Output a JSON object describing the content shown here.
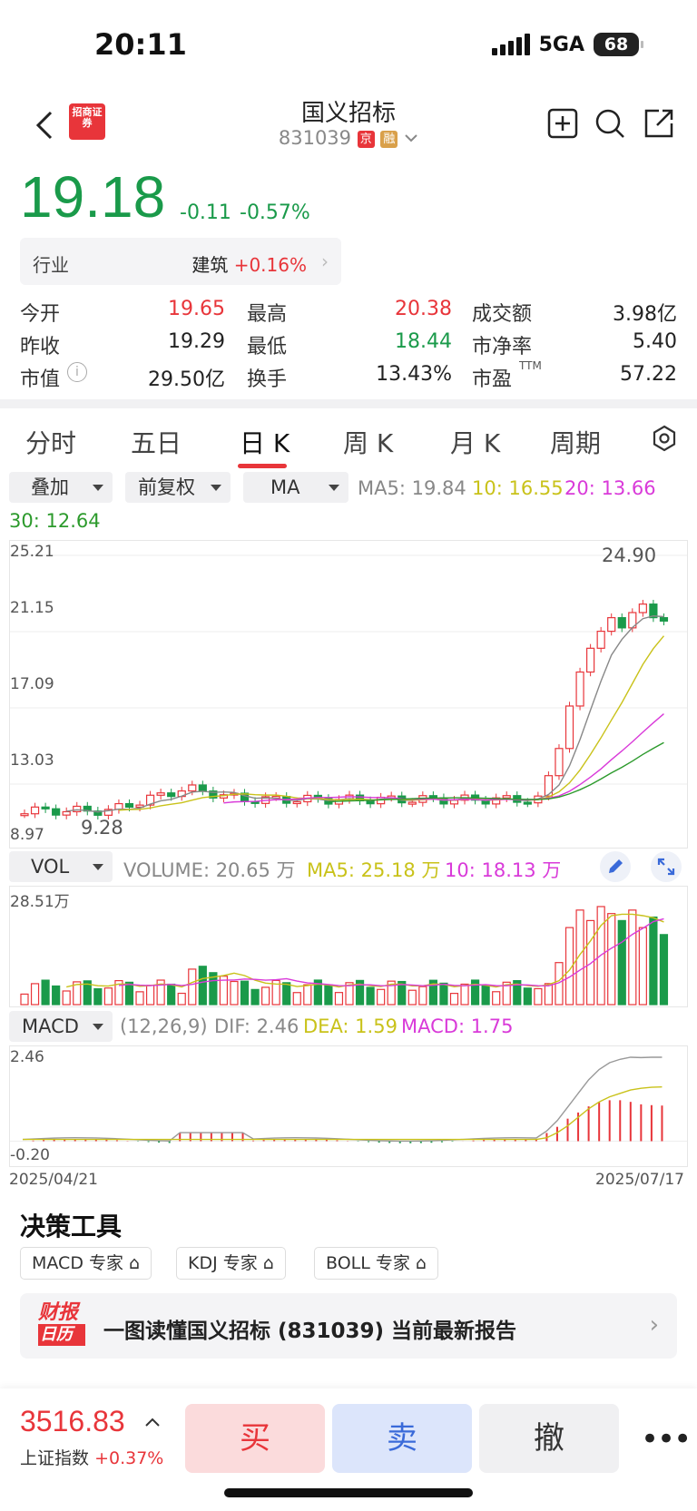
{
  "status": {
    "time": "20:11",
    "network": "5GA",
    "battery": "68"
  },
  "header": {
    "title": "国义招标",
    "code": "831039",
    "tag_jing": "京",
    "tag_rong": "融",
    "logo": "招商证券"
  },
  "quote": {
    "price": "19.18",
    "change": "-0.11",
    "change_pct": "-0.57%"
  },
  "industry": {
    "label": "行业",
    "name": "建筑",
    "change": "+0.16%"
  },
  "stats": [
    {
      "l1": "今开",
      "v1": "19.65",
      "l2": "最高",
      "v2": "20.38",
      "l3": "成交额",
      "v3": "3.98亿"
    },
    {
      "l1": "昨收",
      "v1": "19.29",
      "l2": "最低",
      "v2": "18.44",
      "l3": "市净率",
      "v3": "5.40"
    },
    {
      "l1": "市值",
      "v1": "29.50亿",
      "l2": "换手",
      "v2": "13.43%",
      "l3": "市盈",
      "v3": "57.22",
      "ttm": "TTM"
    }
  ],
  "tabs": [
    "分时",
    "五日",
    "日 K",
    "周 K",
    "月 K",
    "周期"
  ],
  "controls": {
    "overlay": "叠加",
    "adjust": "前复权",
    "indicator": "MA"
  },
  "ma": {
    "ma5": "MA5: 19.84",
    "ma10": "10: 16.55",
    "ma20": "20: 13.66",
    "ma30": "30: 12.64"
  },
  "kline_axis": {
    "y1": "25.21",
    "y2": "21.15",
    "y3": "17.09",
    "y4": "13.03",
    "y5": "8.97",
    "high_label": "24.90",
    "low_label": "9.28"
  },
  "vol": {
    "label": "VOL",
    "volume": "VOLUME: 20.65 万",
    "ma5": "MA5: 25.18 万",
    "ma10": "10: 18.13 万",
    "axis_max": "28.51万"
  },
  "macd": {
    "label": "MACD",
    "params": "(12,26,9)",
    "dif": "DIF: 2.46",
    "dea": "DEA: 1.59",
    "macd": "MACD: 1.75",
    "axis_max": "2.46",
    "axis_min": "-0.20"
  },
  "dates": {
    "start": "2025/04/21",
    "end": "2025/07/17"
  },
  "tools": {
    "title": "决策工具",
    "chips": [
      "MACD 专家",
      "KDJ 专家",
      "BOLL 专家"
    ]
  },
  "banner": {
    "logo_top": "财报",
    "logo_bottom": "日历",
    "text": "一图读懂国义招标 (831039) 当前最新报告"
  },
  "bottom": {
    "index_value": "3516.83",
    "index_name": "上证指数",
    "index_change": "+0.37%",
    "buy": "买",
    "sell": "卖",
    "cancel": "撤"
  },
  "colors": {
    "up": "#e8353a",
    "down": "#1a9a4a",
    "ma5": "#888888",
    "ma10": "#c9c21a",
    "ma20": "#d93ad9",
    "ma30": "#2c9a2c"
  }
}
